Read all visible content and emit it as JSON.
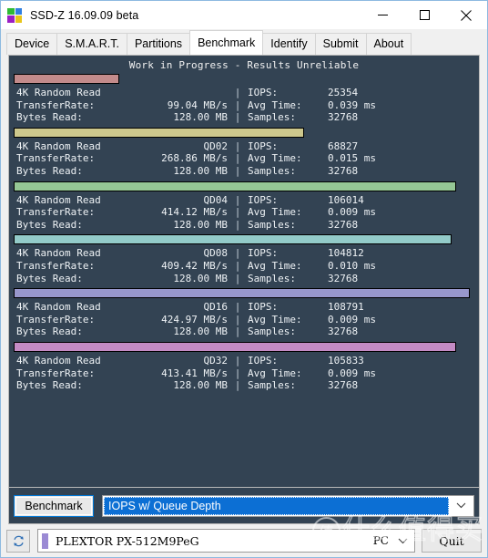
{
  "window": {
    "title": "SSD-Z 16.09.09 beta",
    "icon_name": "ssdz-app-icon",
    "icon_colors": [
      "#2fbb34",
      "#2f7fe0",
      "#9b1fc4",
      "#e8c51a"
    ],
    "controls": {
      "minimize": "minimize-icon",
      "maximize": "maximize-icon",
      "close": "close-icon"
    }
  },
  "tabs": [
    {
      "label": "Device",
      "active": false
    },
    {
      "label": "S.M.A.R.T.",
      "active": false
    },
    {
      "label": "Partitions",
      "active": false
    },
    {
      "label": "Benchmark",
      "active": true
    },
    {
      "label": "Identify",
      "active": false
    },
    {
      "label": "Submit",
      "active": false
    },
    {
      "label": "About",
      "active": false
    }
  ],
  "benchmark_panel": {
    "heading": "Work in Progress - Results Unreliable",
    "background_color": "#334353",
    "labels": {
      "transfer_rate": "TransferRate:",
      "bytes_read": "Bytes Read:",
      "iops": "IOPS:",
      "avg_time": "Avg Time:",
      "samples": "Samples:",
      "separator": "|"
    },
    "results": [
      {
        "test": "4K Random Read",
        "queue_depth": "",
        "transfer_rate": "99.04 MB/s",
        "bytes_read": "128.00 MB",
        "iops": "25354",
        "avg_time": "0.039 ms",
        "samples": "32768",
        "bar_color": "#c38b8b",
        "bar_percent": 23
      },
      {
        "test": "4K Random Read",
        "queue_depth": "QD02",
        "transfer_rate": "268.86 MB/s",
        "bytes_read": "128.00 MB",
        "iops": "68827",
        "avg_time": "0.015 ms",
        "samples": "32768",
        "bar_color": "#cdc88d",
        "bar_percent": 63
      },
      {
        "test": "4K Random Read",
        "queue_depth": "QD04",
        "transfer_rate": "414.12 MB/s",
        "bytes_read": "128.00 MB",
        "iops": "106014",
        "avg_time": "0.009 ms",
        "samples": "32768",
        "bar_color": "#95c795",
        "bar_percent": 96
      },
      {
        "test": "4K Random Read",
        "queue_depth": "QD08",
        "transfer_rate": "409.42 MB/s",
        "bytes_read": "128.00 MB",
        "iops": "104812",
        "avg_time": "0.010 ms",
        "samples": "32768",
        "bar_color": "#93cbc9",
        "bar_percent": 95
      },
      {
        "test": "4K Random Read",
        "queue_depth": "QD16",
        "transfer_rate": "424.97 MB/s",
        "bytes_read": "128.00 MB",
        "iops": "108791",
        "avg_time": "0.009 ms",
        "samples": "32768",
        "bar_color": "#9897cc",
        "bar_percent": 99
      },
      {
        "test": "4K Random Read",
        "queue_depth": "QD32",
        "transfer_rate": "413.41 MB/s",
        "bytes_read": "128.00 MB",
        "iops": "105833",
        "avg_time": "0.009 ms",
        "samples": "32768",
        "bar_color": "#c48bc4",
        "bar_percent": 96
      }
    ]
  },
  "controls": {
    "benchmark_button": "Benchmark",
    "benchmark_select_value": "IOPS w/ Queue Depth",
    "benchmark_select_arrow": "chevron-down-icon",
    "accent_color": "#0c6fd4"
  },
  "status_bar": {
    "refresh_icon": "refresh-icon",
    "device_name": "PLEXTOR PX-512M9PeG",
    "device_chip_color": "#9b8ad4",
    "device_select_arrow": "chevron-down-icon",
    "port_label": "PC",
    "quit_button": "Quit"
  },
  "watermark": {
    "badge": "值",
    "text": "什么值得买"
  }
}
